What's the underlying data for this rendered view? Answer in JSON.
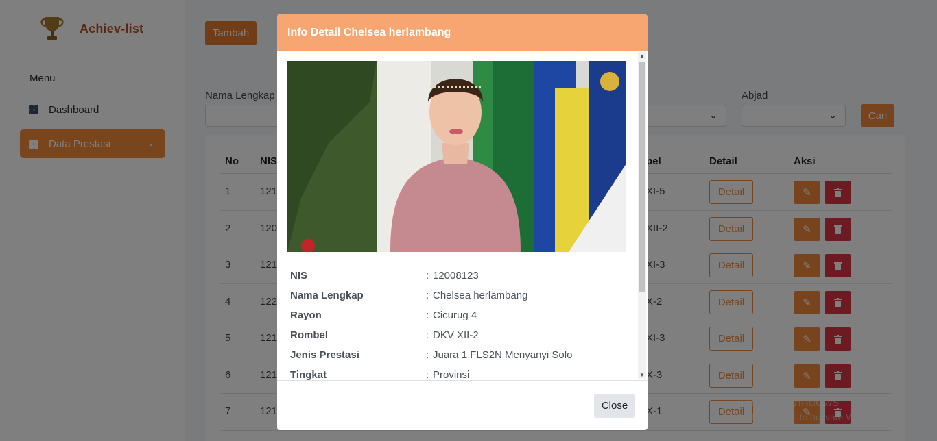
{
  "sidebar": {
    "brand": "Achiev-list",
    "menu_label": "Menu",
    "items": [
      {
        "label": "Dashboard"
      },
      {
        "label": "Data Prestasi"
      }
    ]
  },
  "toolbar": {
    "add_label": "Tambah",
    "search_label": "Cari"
  },
  "filters": {
    "name_label": "Nama Lengkap",
    "abjad_label": "Abjad"
  },
  "table": {
    "headers": [
      "No",
      "NIS",
      "pel",
      "Detail",
      "Aksi"
    ],
    "detail_label": "Detail",
    "rows": [
      {
        "no": "1",
        "nis": "121",
        "rombel": "XI-5"
      },
      {
        "no": "2",
        "nis": "120",
        "rombel": "XII-2"
      },
      {
        "no": "3",
        "nis": "121",
        "rombel": "XI-3"
      },
      {
        "no": "4",
        "nis": "122",
        "rombel": "X-2"
      },
      {
        "no": "5",
        "nis": "121",
        "rombel": "XI-3"
      },
      {
        "no": "6",
        "nis": "121",
        "rombel": "X-3"
      },
      {
        "no": "7",
        "nis": "121",
        "rombel": "X-1"
      }
    ]
  },
  "modal": {
    "title": "Info Detail Chelsea herlambang",
    "close_label": "Close",
    "fields": [
      {
        "key": "NIS",
        "value": "12008123"
      },
      {
        "key": "Nama Lengkap",
        "value": "Chelsea herlambang"
      },
      {
        "key": "Rayon",
        "value": "Cicurug 4"
      },
      {
        "key": "Rombel",
        "value": "DKV XII-2"
      },
      {
        "key": "Jenis Prestasi",
        "value": "Juara 1 FLS2N Menyanyi Solo"
      },
      {
        "key": "Tingkat",
        "value": "Provinsi"
      }
    ]
  },
  "watermark": {
    "line1": "Activate Windows",
    "line2": "Go to Settings to activate Windows."
  },
  "colors": {
    "accent": "#f0883a",
    "modal_header": "#f8a671",
    "danger": "#dc3545",
    "brand": "#b94e21"
  }
}
